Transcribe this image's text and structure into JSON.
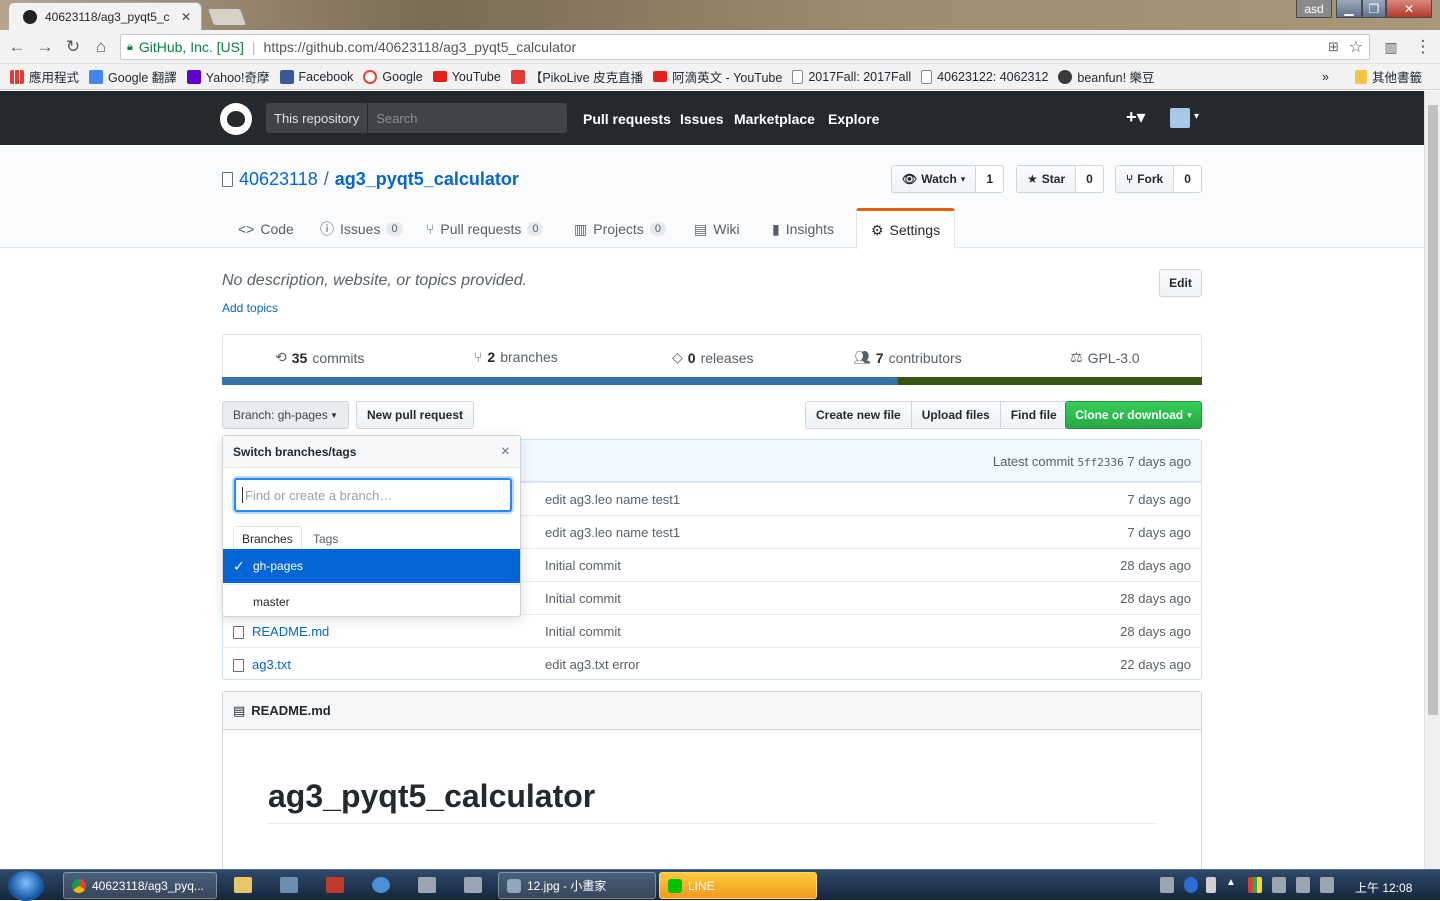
{
  "browser": {
    "tab_title": "40623118/ag3_pyqt5_c",
    "window_user": "asd",
    "security_label": "GitHub, Inc. [US]",
    "url_prefix": "https://github.com",
    "url_path": "/40623118/ag3_pyqt5_calculator",
    "bookmarks": [
      {
        "label": "應用程式",
        "icon": "apps-grid-icon",
        "color": "#4285f4"
      },
      {
        "label": "Google 翻譯",
        "icon": "translate-icon",
        "color": "#4285f4"
      },
      {
        "label": "Yahoo!奇摩",
        "icon": "yahoo-icon",
        "color": "#5f01d1"
      },
      {
        "label": "Facebook",
        "icon": "facebook-icon",
        "color": "#3b5998"
      },
      {
        "label": "Google",
        "icon": "google-icon",
        "color": "#ea4335"
      },
      {
        "label": "YouTube",
        "icon": "youtube-icon",
        "color": "#e62117"
      },
      {
        "label": "【PikoLive 皮克直播",
        "icon": "pikolive-icon",
        "color": "#e53935"
      },
      {
        "label": "阿滴英文 - YouTube",
        "icon": "youtube-icon",
        "color": "#e62117"
      },
      {
        "label": "2017Fall: 2017Fall",
        "icon": "page-icon",
        "color": "#ffffff"
      },
      {
        "label": "40623122: 4062312",
        "icon": "page-icon",
        "color": "#ffffff"
      },
      {
        "label": "beanfun! 樂豆",
        "icon": "beanfun-icon",
        "color": "#3a3a3a"
      }
    ],
    "bookmarks_more": "»",
    "other_bookmarks": "其他書籤"
  },
  "github": {
    "search_scope": "This repository",
    "search_placeholder": "Search",
    "nav": [
      "Pull requests",
      "Issues",
      "Marketplace",
      "Explore"
    ]
  },
  "repo": {
    "owner": "40623118",
    "separator": "/",
    "name": "ag3_pyqt5_calculator",
    "watch_label": "Watch",
    "watch_count": "1",
    "star_label": "Star",
    "star_count": "0",
    "fork_label": "Fork",
    "fork_count": "0",
    "tabs": {
      "code": "Code",
      "issues": "Issues",
      "issues_count": "0",
      "pulls": "Pull requests",
      "pulls_count": "0",
      "projects": "Projects",
      "projects_count": "0",
      "wiki": "Wiki",
      "insights": "Insights",
      "settings": "Settings"
    },
    "description": "No description, website, or topics provided.",
    "add_topics": "Add topics",
    "edit_label": "Edit",
    "summary": {
      "commits_num": "35",
      "commits_label": "commits",
      "branches_num": "2",
      "branches_label": "branches",
      "releases_num": "0",
      "releases_label": "releases",
      "contributors_num": "7",
      "contributors_label": "contributors",
      "license": "GPL-3.0"
    },
    "languages": [
      {
        "color": "#3572A5",
        "percent": 69
      },
      {
        "color": "#375510",
        "percent": 31
      }
    ],
    "branch_button": "Branch: gh-pages",
    "new_pr": "New pull request",
    "create_file": "Create new file",
    "upload_files": "Upload files",
    "find_file": "Find file",
    "clone": "Clone or download",
    "latest_commit_label": "Latest commit",
    "latest_commit_sha": "5ff2336",
    "latest_commit_age": "7 days ago",
    "files": [
      {
        "name": "",
        "message": "edit ag3.leo name test1",
        "age": "7 days ago"
      },
      {
        "name": "",
        "message": "edit ag3.leo name test1",
        "age": "7 days ago"
      },
      {
        "name": "",
        "message": "Initial commit",
        "age": "28 days ago"
      },
      {
        "name": "",
        "message": "Initial commit",
        "age": "28 days ago"
      },
      {
        "name": "README.md",
        "message": "Initial commit",
        "age": "28 days ago"
      },
      {
        "name": "ag3.txt",
        "message": "edit ag3.txt error",
        "age": "22 days ago"
      }
    ],
    "readme_header": "README.md",
    "readme_title": "ag3_pyqt5_calculator"
  },
  "branch_dropdown": {
    "title": "Switch branches/tags",
    "close": "×",
    "filter_placeholder": "Find or create a branch…",
    "tab_branches": "Branches",
    "tab_tags": "Tags",
    "items": [
      {
        "label": "gh-pages",
        "selected": true
      },
      {
        "label": "master",
        "selected": false
      }
    ]
  },
  "taskbar": {
    "items": [
      "40623118/ag3_pyq...",
      "12.jpg - 小畫家",
      "LINE"
    ],
    "clock": "上午 12:08"
  }
}
